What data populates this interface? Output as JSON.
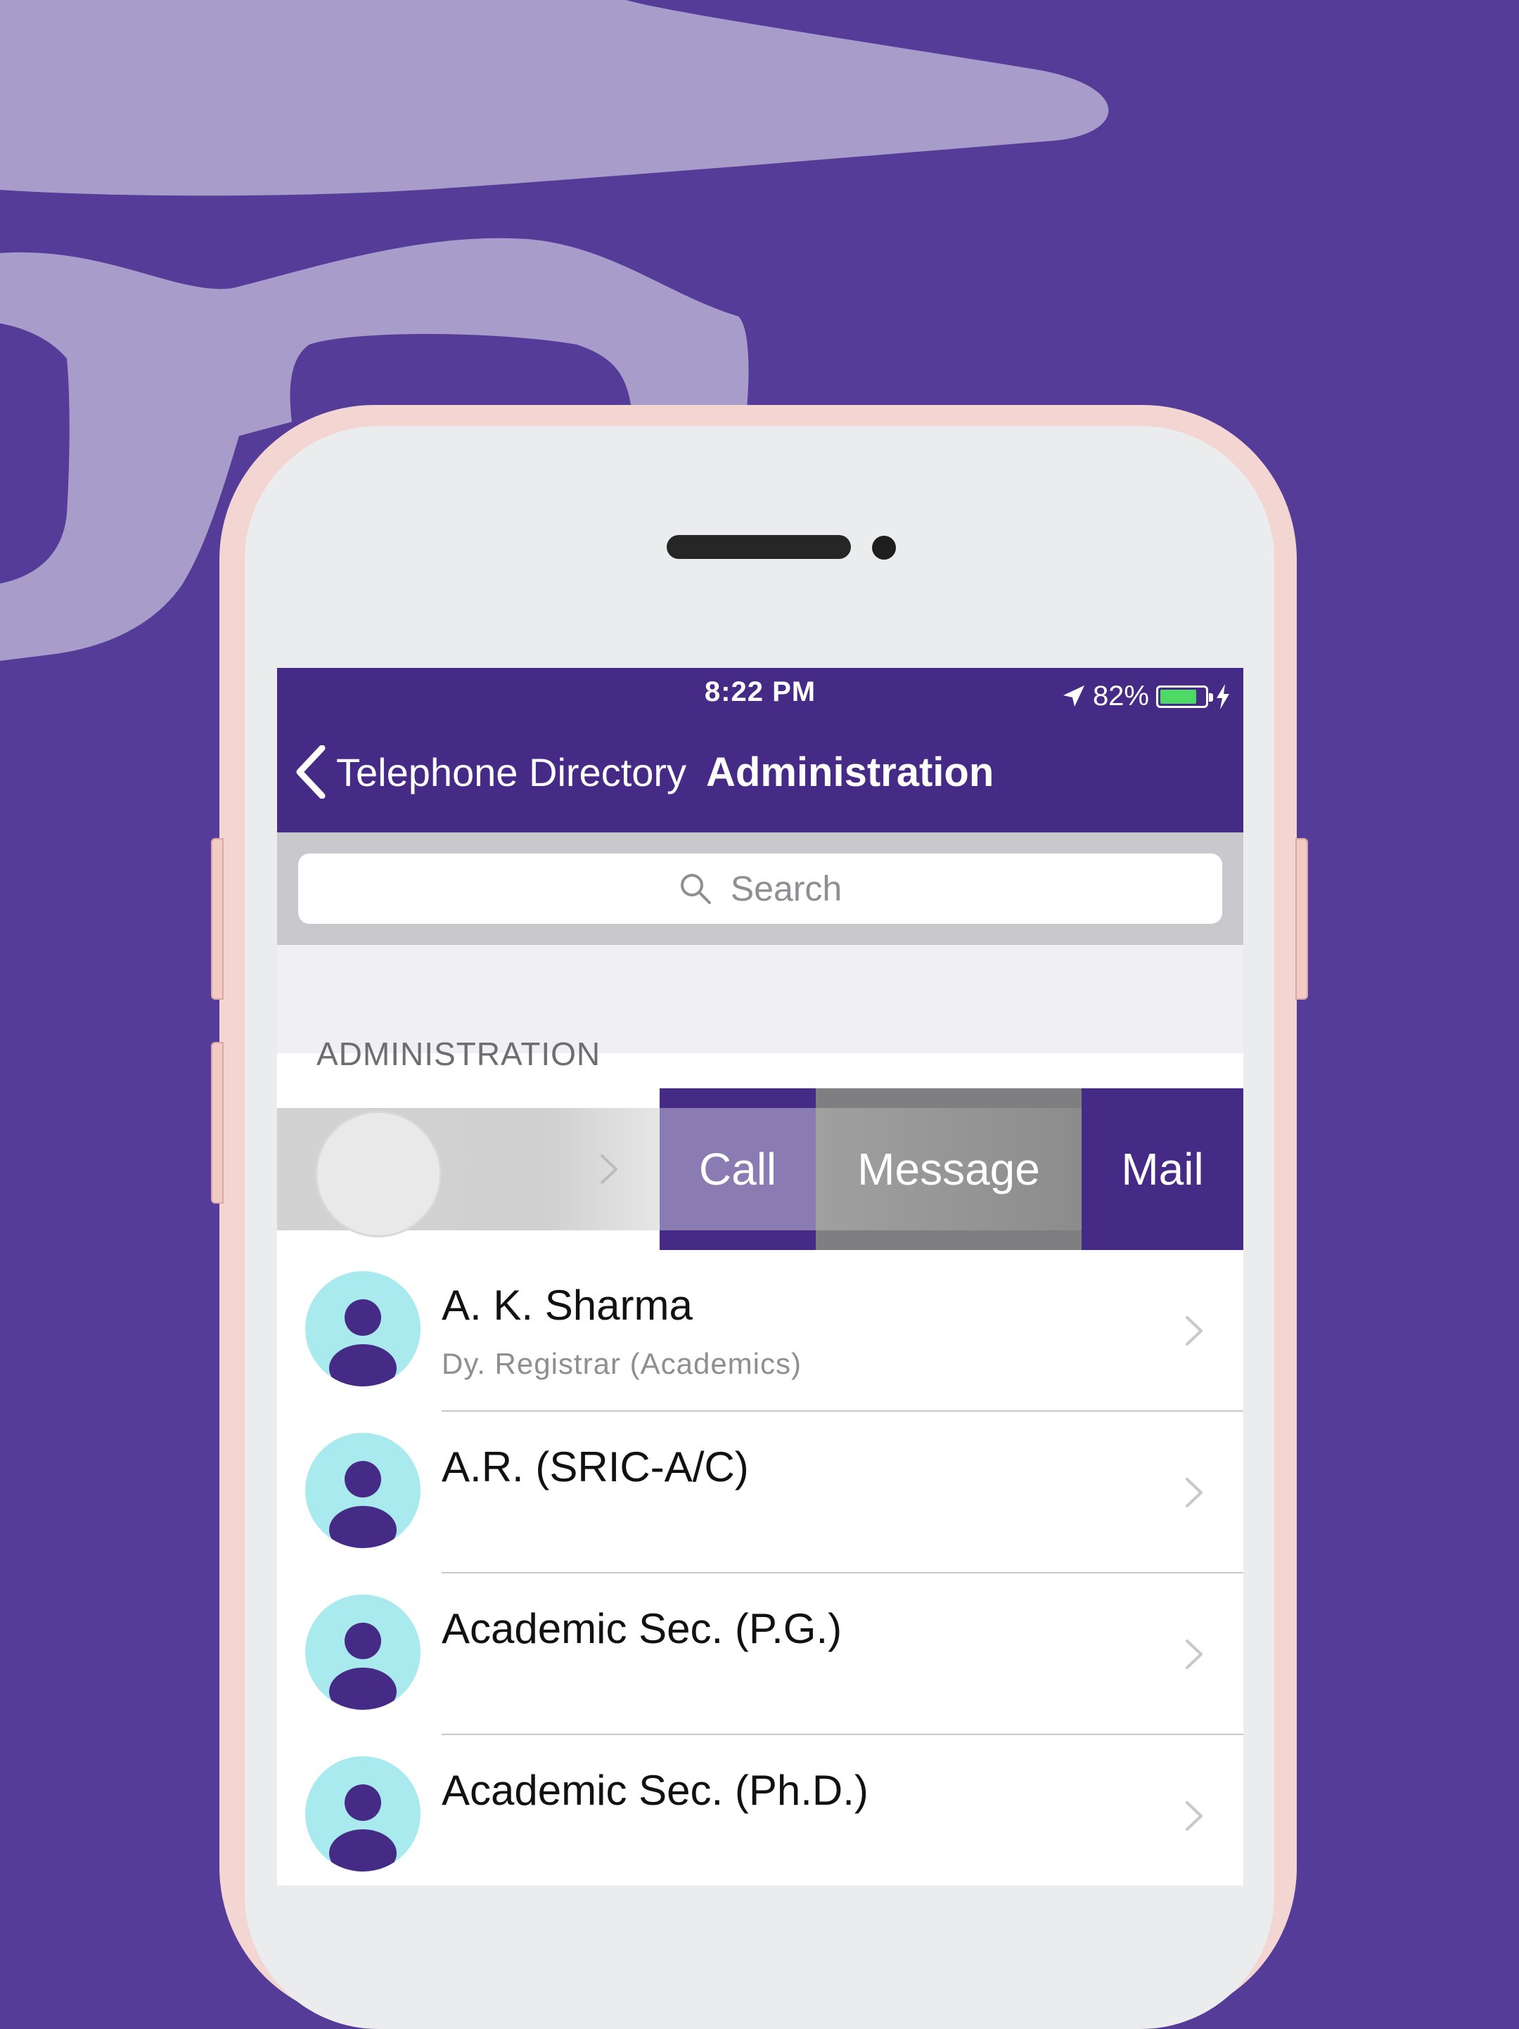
{
  "colors": {
    "background": "#553c98",
    "nav_bar": "#462b86",
    "avatar_bg": "#a9eaef",
    "avatar_figure": "#462b86",
    "battery_fill": "#4cd964"
  },
  "status_bar": {
    "time": "8:22 PM",
    "battery_percent": "82%",
    "battery_level": 0.82,
    "icons": [
      "location-arrow-icon",
      "battery-icon",
      "charging-bolt-icon"
    ]
  },
  "nav": {
    "back_label": "Telephone Directory",
    "title": "Administration"
  },
  "search": {
    "placeholder": "Search"
  },
  "section": {
    "title": "ADMINISTRATION"
  },
  "swipe_actions": {
    "call": "Call",
    "message": "Message",
    "mail": "Mail"
  },
  "contacts": [
    {
      "name": "A. K. Sharma",
      "subtitle": "Dy. Registrar (Academics)"
    },
    {
      "name": "A.R. (SRIC-A/C)",
      "subtitle": ""
    },
    {
      "name": "Academic Sec. (P.G.)",
      "subtitle": ""
    },
    {
      "name": "Academic Sec. (Ph.D.)",
      "subtitle": ""
    }
  ]
}
